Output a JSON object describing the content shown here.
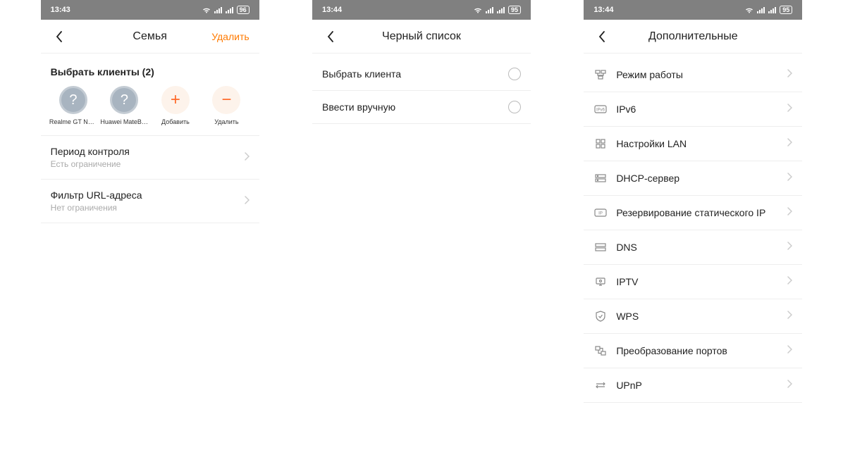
{
  "screen1": {
    "status": {
      "time": "13:43",
      "battery": "96"
    },
    "nav": {
      "title": "Семья",
      "action": "Удалить"
    },
    "clients_header": "Выбрать клиенты (2)",
    "clients": [
      {
        "label": "Realme GT Neo..."
      },
      {
        "label": "Huawei MateBo..."
      }
    ],
    "add_label": "Добавить",
    "remove_label": "Удалить",
    "items": [
      {
        "title": "Период контроля",
        "subtitle": "Есть ограничение"
      },
      {
        "title": "Фильтр URL-адреса",
        "subtitle": "Нет ограничения"
      }
    ]
  },
  "screen2": {
    "status": {
      "time": "13:44",
      "battery": "95"
    },
    "nav": {
      "title": "Черный список"
    },
    "items": [
      {
        "title": "Выбрать клиента"
      },
      {
        "title": "Ввести вручную"
      }
    ]
  },
  "screen3": {
    "status": {
      "time": "13:44",
      "battery": "95"
    },
    "nav": {
      "title": "Дополнительные"
    },
    "items": [
      {
        "title": "Режим работы"
      },
      {
        "title": "IPv6"
      },
      {
        "title": "Настройки LAN"
      },
      {
        "title": "DHCP-сервер"
      },
      {
        "title": "Резервирование статического IP"
      },
      {
        "title": "DNS"
      },
      {
        "title": "IPTV"
      },
      {
        "title": "WPS"
      },
      {
        "title": "Преобразование портов"
      },
      {
        "title": "UPnP"
      }
    ]
  }
}
